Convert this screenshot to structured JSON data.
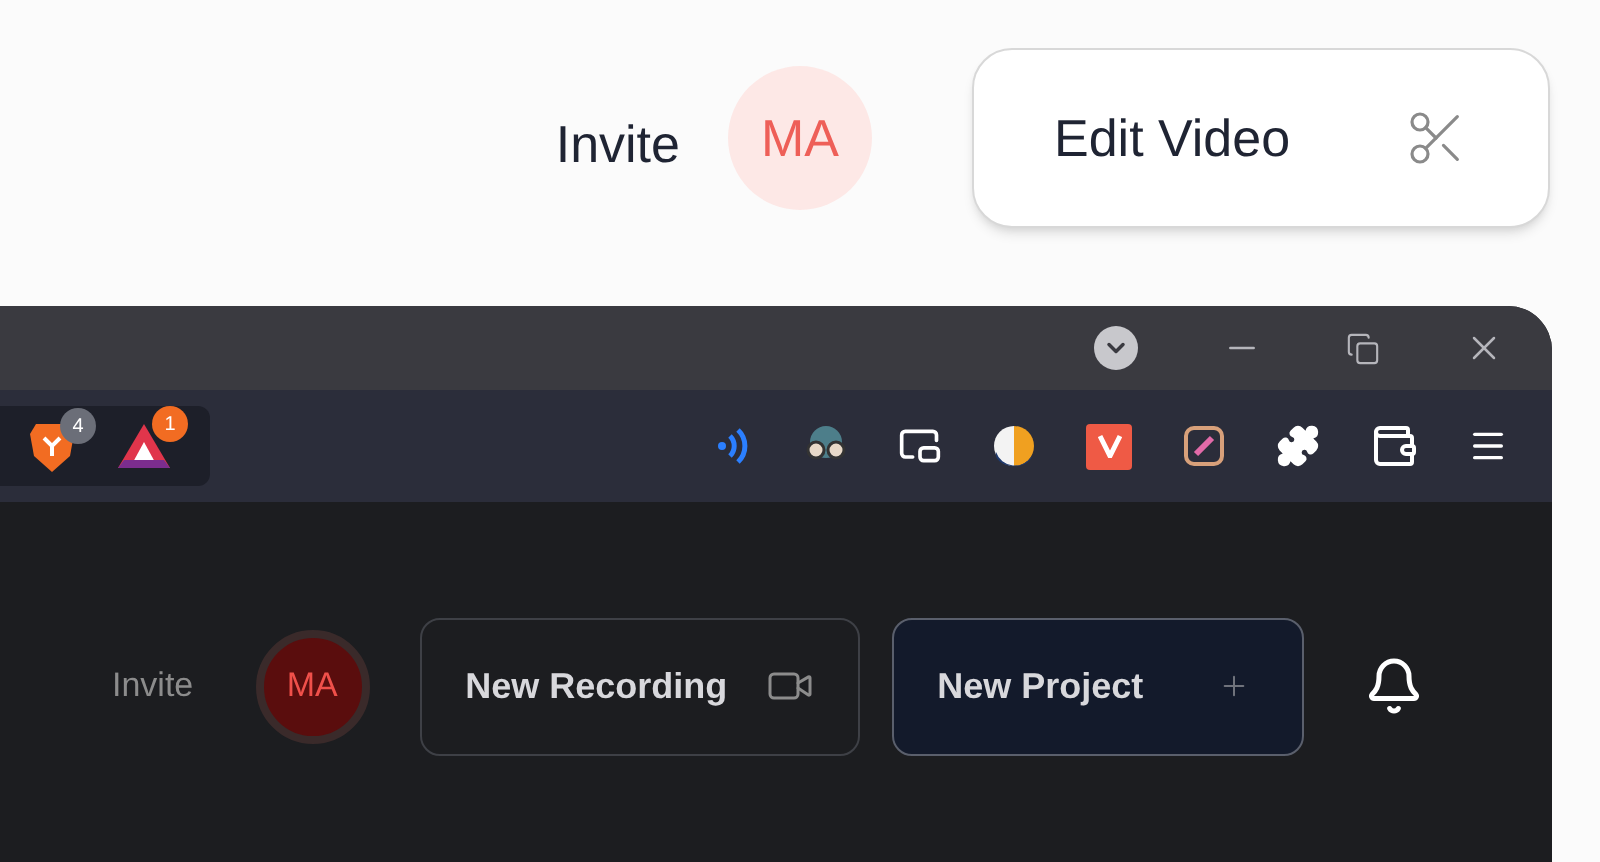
{
  "header": {
    "invite": "Invite",
    "avatar": "MA",
    "edit_button": "Edit Video"
  },
  "browser": {
    "extension_badges": [
      "4",
      "1"
    ]
  },
  "app_toolbar": {
    "invite": "Invite",
    "avatar": "MA",
    "buttons": [
      {
        "label": "New Recording",
        "kind": "recording"
      },
      {
        "label": "New Project",
        "kind": "project"
      }
    ]
  }
}
